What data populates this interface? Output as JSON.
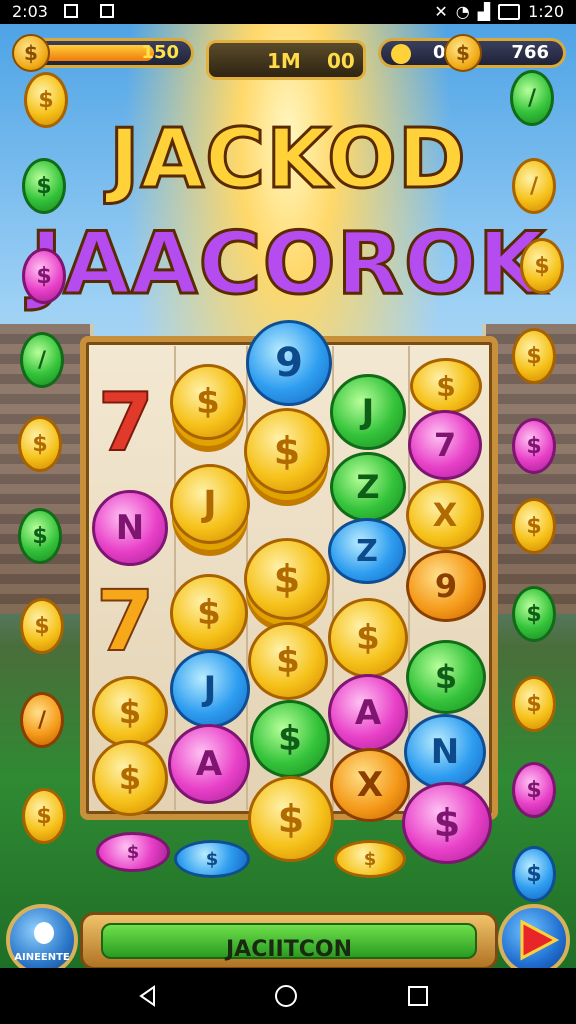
{
  "status_bar": {
    "time": "2:03",
    "clock_right": "1:20"
  },
  "hud": {
    "level_value": "150",
    "level_fill": 0.78,
    "center_left": "1M",
    "center_right": "00",
    "right_left": "0",
    "right_value": "766"
  },
  "title": {
    "line1": "JACKOD",
    "line2": "JAACOROK"
  },
  "board": {
    "symbols": [
      {
        "id": "c9",
        "label": "9"
      },
      {
        "id": "cj",
        "label": "J"
      },
      {
        "id": "cz",
        "label": "Z"
      },
      {
        "id": "cx",
        "label": "X"
      },
      {
        "id": "cn",
        "label": "N"
      },
      {
        "id": "ca",
        "label": "A"
      },
      {
        "id": "c7a",
        "label": "7"
      },
      {
        "id": "c7b",
        "label": "7"
      },
      {
        "id": "d",
        "label": "$"
      }
    ]
  },
  "bottom": {
    "left_button": "AINEENTE",
    "main_button": "JACIITCON"
  },
  "colors": {
    "gold": "#f6c21a",
    "green": "#34c33a",
    "blue": "#2e9df0",
    "pink": "#e840c8",
    "frame": "#c8903a"
  }
}
